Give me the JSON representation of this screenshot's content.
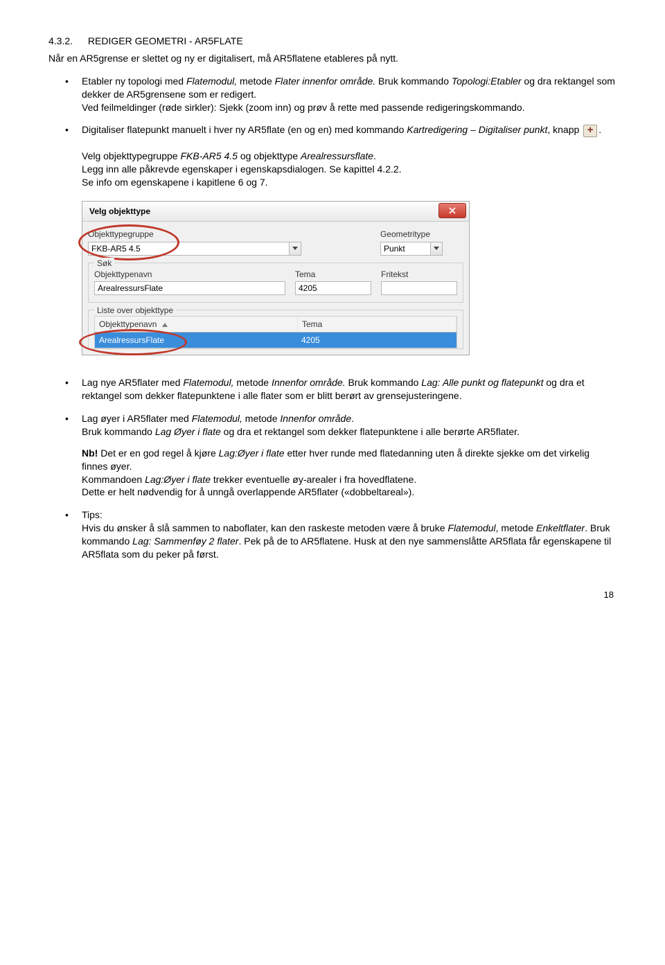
{
  "heading": {
    "number": "4.3.2.",
    "title": "REDIGER GEOMETRI - AR5FLATE"
  },
  "intro": "Når en AR5grense er slettet og ny er digitalisert, må AR5flatene etableres på nytt.",
  "bullets_top": [
    {
      "p1a": "Etabler ny topologi med ",
      "p1b": "Flatemodul,",
      "p1c": " metode ",
      "p1d": "Flater innenfor område.",
      "p1e": " Bruk kommando ",
      "p1f": "Topologi:Etabler",
      "p1g": " og dra rektangel som dekker de AR5grensene som er redigert.",
      "p2": "Ved feilmeldinger (røde sirkler): Sjekk (zoom inn) og prøv å rette med passende redigeringskommando."
    },
    {
      "p1a": "Digitaliser flatepunkt manuelt i hver ny AR5flate (en og en) med kommando ",
      "p1b": "Kartredigering – Digitaliser punkt",
      "p1c": ", knapp ",
      "p1d": "."
    }
  ],
  "midblock": {
    "l1a": "Velg objekttypegruppe ",
    "l1b": "FKB-AR5 4.5",
    "l1c": " og objekttype ",
    "l1d": "Arealressursflate",
    "l1e": ".",
    "l2": "Legg inn alle påkrevde egenskaper i egenskapsdialogen. Se kapittel 4.2.2.",
    "l3": "Se info om egenskapene i kapitlene 6 og 7."
  },
  "dialog": {
    "title": "Velg objekttype",
    "group1": {
      "left_label": "Objekttypegruppe",
      "left_value": "FKB-AR5 4.5",
      "right_label": "Geometritype",
      "right_value": "Punkt"
    },
    "sok_legend": "Søk",
    "sok": {
      "navn_label": "Objekttypenavn",
      "navn_value": "ArealressursFlate",
      "tema_label": "Tema",
      "tema_value": "4205",
      "fritekst_label": "Fritekst",
      "fritekst_value": ""
    },
    "liste_legend": "Liste over objekttype",
    "liste": {
      "col1": "Objekttypenavn",
      "col2": "Tema",
      "row_name": "ArealressursFlate",
      "row_tema": "4205"
    }
  },
  "bullets_bottom": [
    {
      "p1a": "Lag nye AR5flater med ",
      "p1b": "Flatemodul,",
      "p1c": " metode ",
      "p1d": "Innenfor område.",
      "p1e": " Bruk kommando ",
      "p1f": "Lag: Alle punkt og flatepunkt",
      "p1g": " og dra et rektangel som dekker flatepunktene i alle flater som er blitt berørt av grensejusteringene."
    },
    {
      "p1a": "Lag øyer i AR5flater med ",
      "p1b": "Flatemodul,",
      "p1c": " metode ",
      "p1d": "Innenfor område",
      "p1e": ".",
      "p2a": "Bruk kommando ",
      "p2b": "Lag Øyer i flate",
      "p2c": " og dra et rektangel som dekker flatepunktene i alle berørte AR5flater.",
      "nb_label": "Nb!",
      "nb1a": " Det er en god regel å kjøre ",
      "nb1b": "Lag:Øyer i flate",
      "nb1c": " etter hver runde med flatedanning uten å direkte sjekke om det virkelig finnes øyer.",
      "nb2a": "Kommandoen ",
      "nb2b": "Lag:Øyer i flate",
      "nb2c": " trekker eventuelle øy-arealer i fra hovedflatene.",
      "nb3a": "Dette er helt nødvendig for å unngå overlappende AR5flater (",
      "nb3b": "«dobbeltareal»",
      "nb3c": ")."
    },
    {
      "tips_label": "Tips:",
      "t1a": "Hvis du ønsker å slå sammen to naboflater, kan den raskeste metoden være å bruke ",
      "t1b": "Flatemodul",
      "t1c": ", metode ",
      "t1d": "Enkeltflater",
      "t1e": ". Bruk kommando ",
      "t1f": "Lag: Sammenføy 2 flater",
      "t1g": ". Pek på de to AR5flatene. Husk at den nye sammenslåtte AR5flata får egenskapene til AR5flata som du peker på først."
    }
  ],
  "page_number": "18"
}
